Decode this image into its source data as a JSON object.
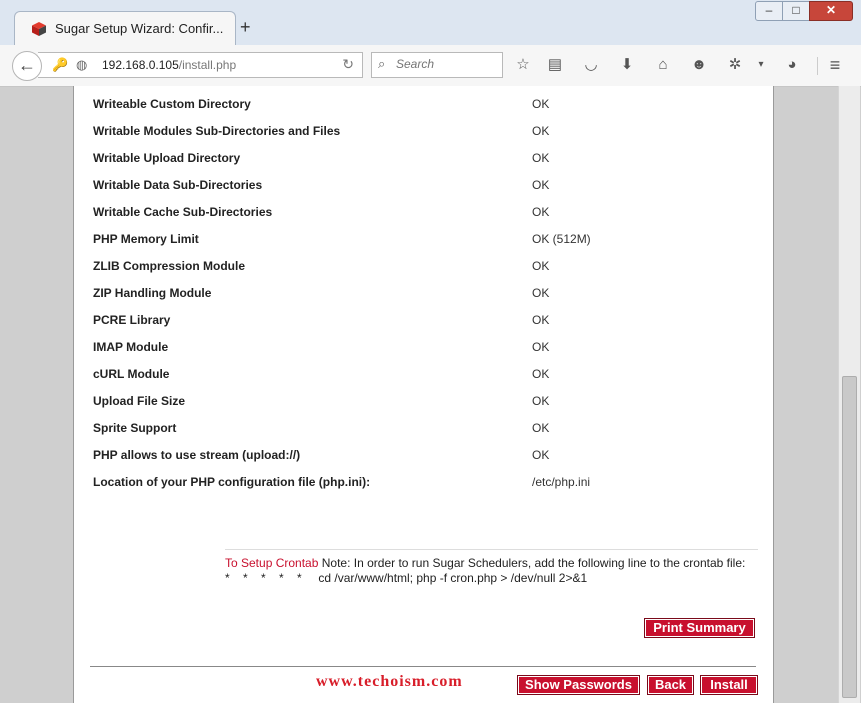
{
  "browser": {
    "tab_title": "Sugar Setup Wizard: Confir...",
    "new_tab": "+",
    "window_controls": {
      "minimize": "▭",
      "maximize": "□",
      "close": "✕"
    },
    "url_host": "192.168.0.105",
    "url_path": "/install.php",
    "search_placeholder": "Search",
    "icons": [
      "bookmark-star-icon",
      "reading-list-icon",
      "pocket-icon",
      "download-icon",
      "home-icon",
      "chat-icon",
      "extension-icon",
      "dropdown-icon",
      "extension2-icon",
      "menu-icon"
    ]
  },
  "checks": [
    {
      "label": "Writeable Custom Directory",
      "value": "OK"
    },
    {
      "label": "Writable Modules Sub-Directories and Files",
      "value": "OK"
    },
    {
      "label": "Writable Upload Directory",
      "value": "OK"
    },
    {
      "label": "Writable Data Sub-Directories",
      "value": "OK"
    },
    {
      "label": "Writable Cache Sub-Directories",
      "value": "OK"
    },
    {
      "label": "PHP Memory Limit",
      "value": "OK (512M)"
    },
    {
      "label": "ZLIB Compression Module",
      "value": "OK"
    },
    {
      "label": "ZIP Handling Module",
      "value": "OK"
    },
    {
      "label": "PCRE Library",
      "value": "OK"
    },
    {
      "label": "IMAP Module",
      "value": "OK"
    },
    {
      "label": "cURL Module",
      "value": "OK"
    },
    {
      "label": "Upload File Size",
      "value": "OK"
    },
    {
      "label": "Sprite Support",
      "value": "OK"
    },
    {
      "label": "PHP allows to use stream (upload://)",
      "value": "OK"
    },
    {
      "label": "Location of your PHP configuration file (php.ini):",
      "value": "/etc/php.ini"
    }
  ],
  "cron": {
    "link": "To Setup Crontab",
    "note": " Note: In order to run Sugar Schedulers, add the following line to the crontab file:",
    "line": "*    *    *    *    *     cd /var/www/html; php -f cron.php > /dev/null 2>&1"
  },
  "buttons": {
    "print_summary": "Print Summary",
    "show_passwords": "Show Passwords",
    "back": "Back",
    "install": "Install"
  },
  "watermark": "www.techoism.com",
  "colors": {
    "accent": "#c8102e",
    "watermark": "#d81e2a"
  }
}
